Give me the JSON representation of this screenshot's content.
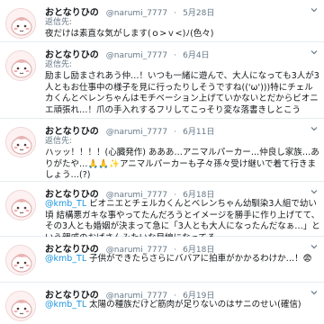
{
  "tweets": [
    {
      "name": "おとなりひの",
      "handle": "@narumi_7777",
      "date": "5月28日",
      "reply_label": "返信先:",
      "mention": "",
      "text": "夜だけは素直な気がします(ｏ>ｖ<)ﾉ(色々)"
    },
    {
      "name": "おとなりひの",
      "handle": "@narumi_7777",
      "date": "6月4日",
      "reply_label": "返信先:",
      "mention": "",
      "text": "励まし励まされあう仲…！いつも一緒に遊んで、大人になっても3人が3人ともお仕事中の様子を見に行ったりしそうですね(('ω')))特にチェルカくんとベレンちゃんはモチベーション上げていかないとだからビオニエ頑張れ…！爪の手入れするフリしてこっそり変な落書きしとこう"
    },
    {
      "name": "おとなりひの",
      "handle": "@narumi_7777",
      "date": "6月11日",
      "reply_label": "返信先:",
      "mention": "",
      "text": "ハッッ！！！！(心臓発作) あああ…アニマルパーカー…仲良し家族…ありがたや…🙏🙏✨アニマルパーカーも子々孫々受け継いで着て行きましょう…(?)"
    },
    {
      "name": "おとなりひの",
      "handle": "@narumi_7777",
      "date": "6月18日",
      "reply_label": "",
      "mention": "@kmb_TL",
      "text": " ビオニエとチェルカくんとベレンちゃん幼馴染3人組で幼い頃 結構悪ガキな事やってたんだろうとイメージを勝手に作り上げてて、その3人とも婚姻が決まって急に「3人とも大人になったんだなぁ…」という親戚のおばさんみたいな目線になってる"
    },
    {
      "name": "おとなりひの",
      "handle": "@narumi_7777",
      "date": "6月18日",
      "reply_label": "",
      "mention": "@kmb_TL",
      "text": " 子供ができたらさらにババアに拍車がかかるわけか…！😨"
    },
    {
      "name": "おとなりひの",
      "handle": "@narumi_7777",
      "date": "6月19日",
      "reply_label": "",
      "mention": "@kmb_TL",
      "text": " 太陽の種族だけど筋肉が足りないのはサニのせい(確信)"
    }
  ]
}
